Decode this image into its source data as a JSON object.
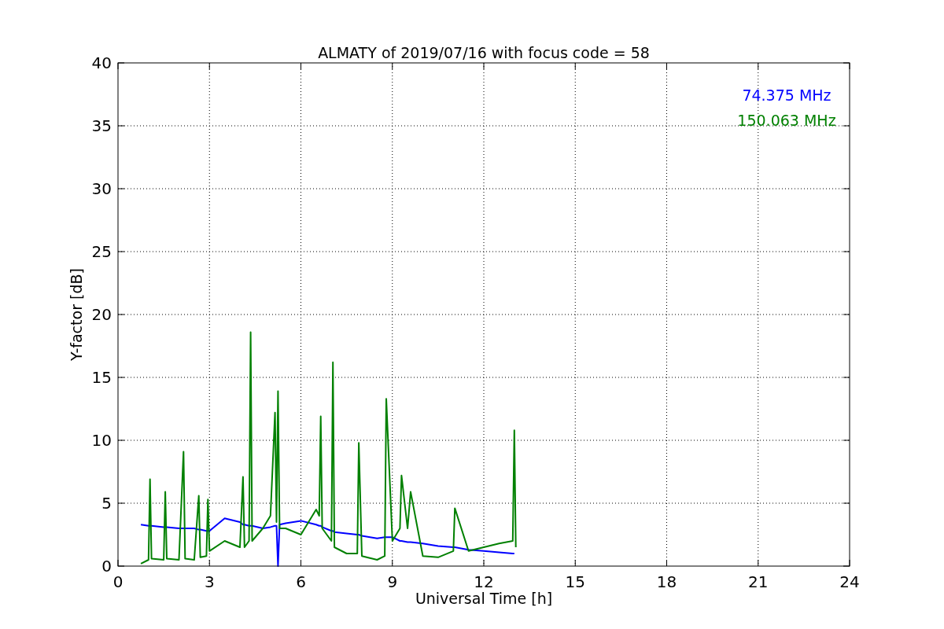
{
  "chart_data": {
    "type": "line",
    "title": "ALMATY of 2019/07/16 with focus code = 58",
    "xlabel": "Universal Time [h]",
    "ylabel": "Y-factor [dB]",
    "x": [
      0.75,
      1.0,
      1.05,
      1.1,
      1.5,
      1.55,
      1.6,
      2.0,
      2.15,
      2.2,
      2.5,
      2.65,
      2.7,
      2.9,
      2.95,
      3.0,
      3.5,
      4.0,
      4.1,
      4.15,
      4.3,
      4.35,
      4.4,
      4.75,
      5.0,
      5.15,
      5.2,
      5.25,
      5.3,
      5.5,
      6.0,
      6.5,
      6.6,
      6.65,
      6.7,
      7.0,
      7.05,
      7.1,
      7.5,
      7.85,
      7.9,
      8.0,
      8.5,
      8.75,
      8.8,
      9.0,
      9.25,
      9.3,
      9.5,
      9.6,
      10.0,
      10.5,
      11.0,
      11.05,
      11.5,
      12.0,
      12.5,
      12.95,
      13.0,
      13.05
    ],
    "series": [
      {
        "name": "74.375 MHz",
        "color": "#0000ff",
        "values": [
          3.3,
          3.2,
          3.2,
          3.2,
          3.1,
          3.1,
          3.1,
          3.0,
          3.0,
          3.0,
          3.0,
          2.9,
          2.9,
          2.8,
          2.8,
          2.8,
          3.8,
          3.5,
          3.3,
          3.3,
          3.2,
          3.2,
          3.2,
          3.0,
          3.1,
          3.2,
          3.2,
          0.0,
          3.3,
          3.4,
          3.6,
          3.3,
          3.2,
          3.2,
          3.1,
          2.8,
          2.8,
          2.7,
          2.6,
          2.5,
          2.5,
          2.4,
          2.2,
          2.3,
          2.3,
          2.3,
          2.0,
          2.0,
          1.9,
          1.9,
          1.8,
          1.6,
          1.5,
          1.5,
          1.3,
          1.2,
          1.1,
          1.0,
          1.0,
          null
        ]
      },
      {
        "name": "150.063 MHz",
        "color": "#008000",
        "values": [
          0.2,
          0.5,
          6.9,
          0.6,
          0.5,
          5.9,
          0.6,
          0.5,
          9.1,
          0.6,
          0.5,
          5.6,
          0.7,
          0.8,
          5.3,
          1.2,
          2.0,
          1.5,
          7.1,
          1.5,
          2.0,
          18.6,
          2.0,
          3.0,
          4.0,
          12.2,
          3.5,
          13.9,
          3.0,
          3.0,
          2.5,
          4.5,
          4.0,
          11.9,
          3.0,
          2.0,
          16.2,
          1.5,
          1.0,
          1.0,
          9.8,
          0.8,
          0.5,
          0.8,
          13.3,
          2.0,
          3.0,
          7.2,
          3.0,
          5.9,
          0.8,
          0.7,
          1.2,
          4.6,
          1.2,
          1.5,
          1.8,
          2.0,
          10.8,
          1.5
        ]
      }
    ],
    "grid": true,
    "xlim": [
      0,
      24
    ],
    "ylim": [
      0,
      40
    ],
    "xticks": [
      0,
      3,
      6,
      9,
      12,
      15,
      18,
      21,
      24
    ],
    "yticks": [
      0,
      5,
      10,
      15,
      20,
      25,
      30,
      35,
      40
    ]
  }
}
